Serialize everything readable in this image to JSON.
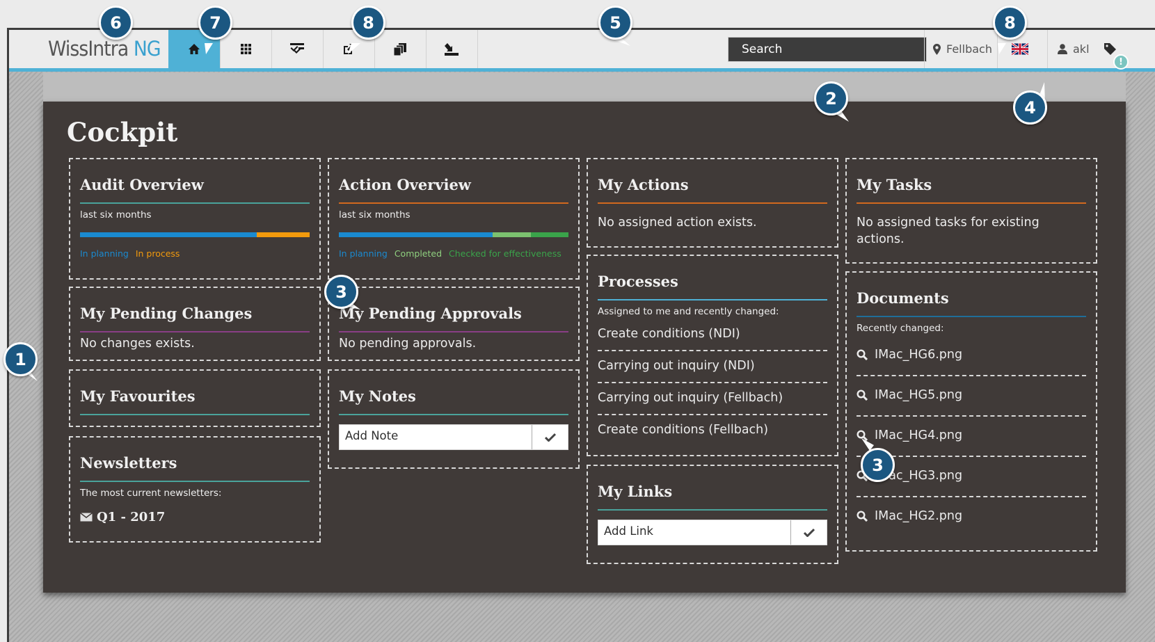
{
  "app": {
    "logo_part1": "WissIntra",
    "logo_part2": " NG"
  },
  "nav": {
    "items": [
      {
        "icon": "home-icon"
      },
      {
        "icon": "grid-icon"
      },
      {
        "icon": "checklist-icon"
      },
      {
        "icon": "external-link-icon"
      },
      {
        "icon": "copy-icon"
      },
      {
        "icon": "download-icon"
      }
    ]
  },
  "topbar": {
    "search_placeholder": "Search",
    "location": "Fellbach",
    "language_icon": "uk-flag-icon",
    "user": "akl",
    "tag_icon": "tag-icon",
    "alert": "!"
  },
  "page": {
    "title": "Cockpit"
  },
  "colors": {
    "accent": "#4fb1d6",
    "panel": "#403a38",
    "callout": "#1b5781",
    "planning": "#1a8ad0",
    "process": "#f29a0d",
    "completed": "#7cc16f",
    "checked": "#3aa34a"
  },
  "audit": {
    "title": "Audit Overview",
    "subtitle": "last six months",
    "bar": [
      {
        "label": "In planning",
        "share": 0.77
      },
      {
        "label": "In process",
        "share": 0.23
      }
    ]
  },
  "action_overview": {
    "title": "Action Overview",
    "subtitle": "last six months",
    "bar": [
      {
        "label": "In planning",
        "share": 0.67
      },
      {
        "label": "Completed",
        "share": 0.165
      },
      {
        "label": "Checked for effectiveness",
        "share": 0.165
      }
    ]
  },
  "my_actions": {
    "title": "My Actions",
    "text": "No assigned action exists."
  },
  "my_tasks": {
    "title": "My Tasks",
    "text": "No assigned tasks for existing actions."
  },
  "pending_changes": {
    "title": "My Pending Changes",
    "text": "No changes exists."
  },
  "pending_approvals": {
    "title": "My Pending Approvals",
    "text": "No pending approvals."
  },
  "processes": {
    "title": "Processes",
    "subtitle": "Assigned to me and recently changed:",
    "items": [
      "Create conditions (NDI)",
      "Carrying out inquiry (NDI)",
      "Carrying out inquiry (Fellbach)",
      "Create conditions (Fellbach)"
    ]
  },
  "documents": {
    "title": "Documents",
    "subtitle": "Recently changed:",
    "items": [
      "IMac_HG6.png",
      "IMac_HG5.png",
      "IMac_HG4.png",
      "IMac_HG3.png",
      "IMac_HG2.png"
    ]
  },
  "favourites": {
    "title": "My Favourites"
  },
  "notes": {
    "title": "My Notes",
    "input": "Add Note"
  },
  "newsletters": {
    "title": "Newsletters",
    "subtitle": "The most current newsletters:",
    "item": "Q1 - 2017"
  },
  "links": {
    "title": "My Links",
    "input": "Add Link"
  },
  "callouts": [
    "1",
    "2",
    "3",
    "3",
    "4",
    "5",
    "6",
    "7",
    "8",
    "8"
  ]
}
